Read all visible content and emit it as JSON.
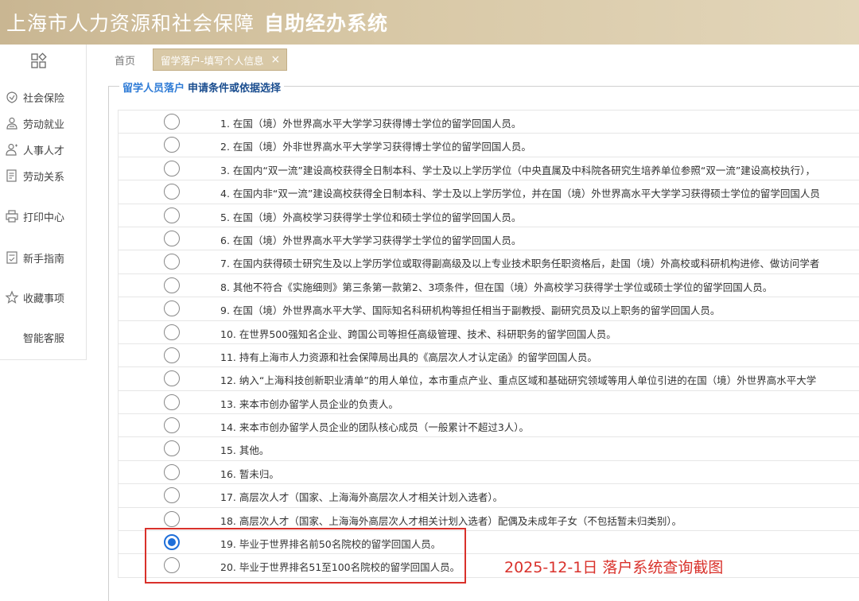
{
  "header": {
    "title_main": "上海市人力资源和社会保障",
    "title_sub": "自助经办系统"
  },
  "sidebar": {
    "items": [
      {
        "label": "社会保险",
        "icon": "social-insurance-icon"
      },
      {
        "label": "劳动就业",
        "icon": "employment-icon"
      },
      {
        "label": "人事人才",
        "icon": "talent-icon"
      },
      {
        "label": "劳动关系",
        "icon": "labor-relations-icon"
      },
      {
        "label": "打印中心",
        "icon": "printer-icon"
      },
      {
        "label": "新手指南",
        "icon": "guide-icon"
      },
      {
        "label": "收藏事项",
        "icon": "star-icon"
      },
      {
        "label": "智能客服",
        "icon": ""
      }
    ]
  },
  "tabs": {
    "home": "首页",
    "active": "留学落户-填写个人信息",
    "close": "×"
  },
  "legend": {
    "part1": "留学人员落户",
    "part2": "申请条件或依据选择"
  },
  "options": [
    {
      "text": "1. 在国（境）外世界高水平大学学习获得博士学位的留学回国人员。",
      "checked": false
    },
    {
      "text": "2. 在国（境）外非世界高水平大学学习获得博士学位的留学回国人员。",
      "checked": false
    },
    {
      "text": "3. 在国内“双一流”建设高校获得全日制本科、学士及以上学历学位（中央直属及中科院各研究生培养单位参照“双一流”建设高校执行），",
      "checked": false
    },
    {
      "text": "4. 在国内非“双一流”建设高校获得全日制本科、学士及以上学历学位，并在国（境）外世界高水平大学学习获得硕士学位的留学回国人员",
      "checked": false
    },
    {
      "text": "5. 在国（境）外高校学习获得学士学位和硕士学位的留学回国人员。",
      "checked": false
    },
    {
      "text": "6. 在国（境）外世界高水平大学学习获得学士学位的留学回国人员。",
      "checked": false
    },
    {
      "text": "7. 在国内获得硕士研究生及以上学历学位或取得副高级及以上专业技术职务任职资格后，赴国（境）外高校或科研机构进修、做访问学者",
      "checked": false
    },
    {
      "text": "8. 其他不符合《实施细则》第三条第一款第2、3项条件，但在国（境）外高校学习获得学士学位或硕士学位的留学回国人员。",
      "checked": false
    },
    {
      "text": "9. 在国（境）外世界高水平大学、国际知名科研机构等担任相当于副教授、副研究员及以上职务的留学回国人员。",
      "checked": false
    },
    {
      "text": "10. 在世界500强知名企业、跨国公司等担任高级管理、技术、科研职务的留学回国人员。",
      "checked": false
    },
    {
      "text": "11. 持有上海市人力资源和社会保障局出具的《高层次人才认定函》的留学回国人员。",
      "checked": false
    },
    {
      "text": "12. 纳入“上海科技创新职业清单”的用人单位，本市重点产业、重点区域和基础研究领域等用人单位引进的在国（境）外世界高水平大学",
      "checked": false
    },
    {
      "text": "13. 来本市创办留学人员企业的负责人。",
      "checked": false
    },
    {
      "text": "14. 来本市创办留学人员企业的团队核心成员（一般累计不超过3人）。",
      "checked": false
    },
    {
      "text": "15. 其他。",
      "checked": false
    },
    {
      "text": "16. 暂未归。",
      "checked": false
    },
    {
      "text": "17. 高层次人才（国家、上海海外高层次人才相关计划入选者）。",
      "checked": false
    },
    {
      "text": "18. 高层次人才（国家、上海海外高层次人才相关计划入选者）配偶及未成年子女（不包括暂未归类别）。",
      "checked": false
    },
    {
      "text": "19. 毕业于世界排名前50名院校的留学回国人员。",
      "checked": true
    },
    {
      "text": "20. 毕业于世界排名51至100名院校的留学回国人员。",
      "checked": false
    }
  ],
  "annotation": "2025-12-1日 落户系统查询截图",
  "colors": {
    "header_bg": "#d8c8a6",
    "accent_blue": "#1e6fd9",
    "annotation_red": "#d9312b"
  }
}
